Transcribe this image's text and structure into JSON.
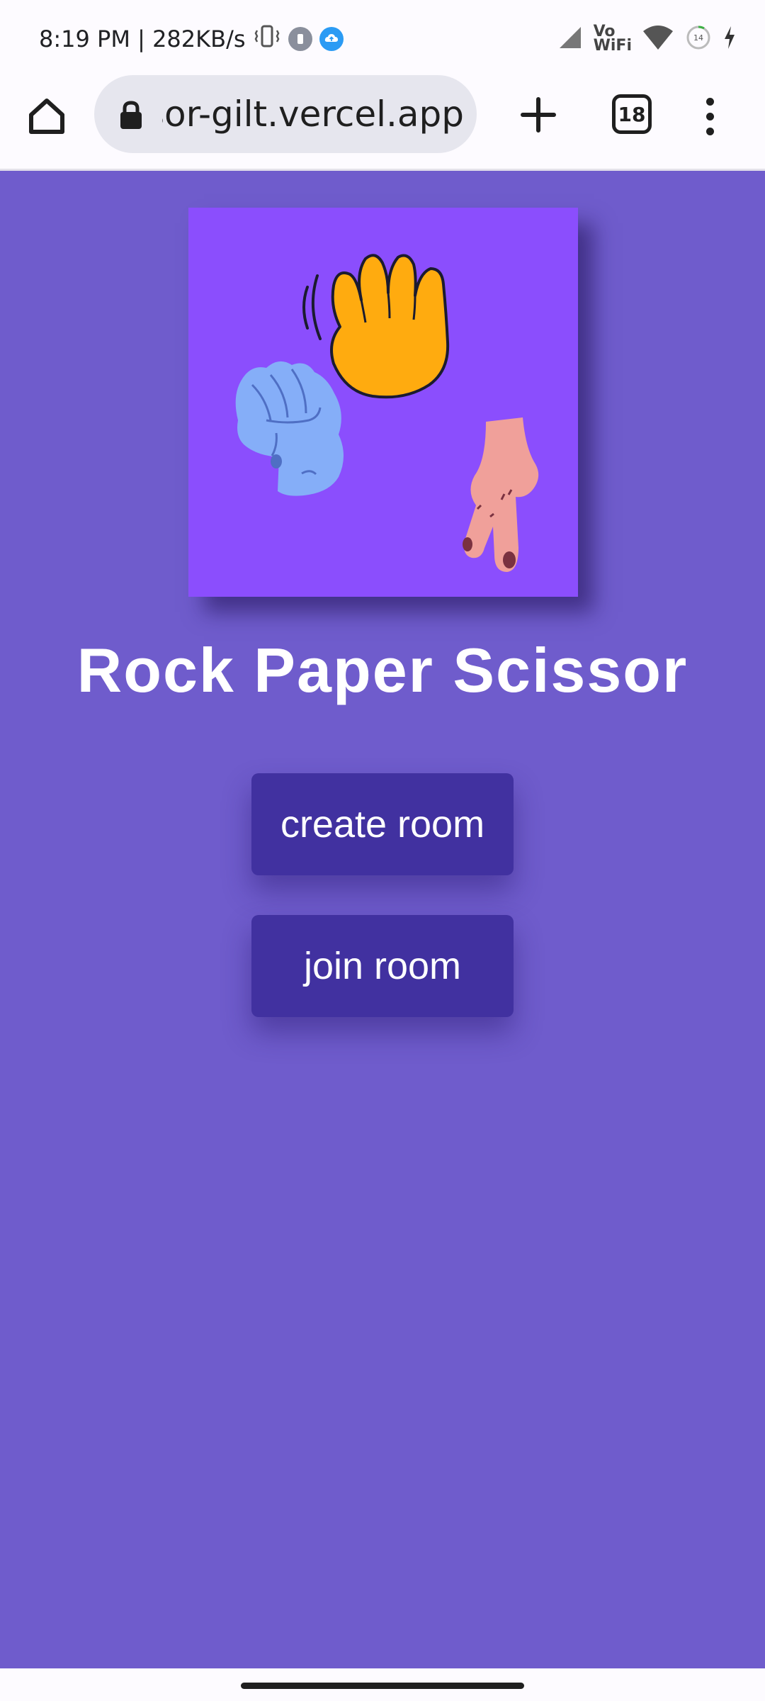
{
  "status_bar": {
    "time_speed": "8:19 PM | 282KB/s",
    "vowifi_top": "Vo",
    "vowifi_bottom": "WiFi",
    "battery_level": "14"
  },
  "browser": {
    "url": "rock-paper-scissor-gilt.vercel.app",
    "tab_count": "18"
  },
  "page": {
    "title": "Rock Paper Scissor",
    "create_room_label": "create room",
    "join_room_label": "join room",
    "colors": {
      "background": "#6f5ccc",
      "hero": "#8b4efd",
      "button": "#4131a0",
      "paper_hand": "#ffab0f",
      "rock_hand": "#85aef8",
      "scissor_hand": "#f0a09a"
    }
  }
}
